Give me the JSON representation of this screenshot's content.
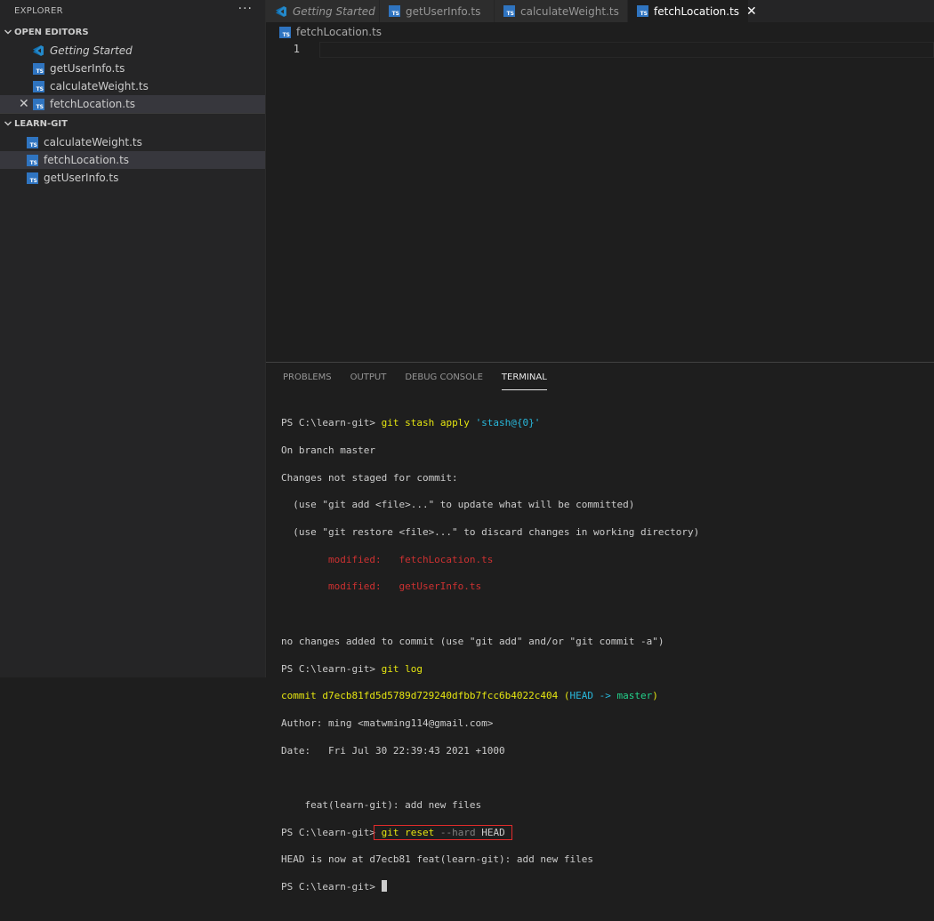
{
  "sidebar": {
    "title": "EXPLORER",
    "more": "···",
    "open_editors": {
      "label": "OPEN EDITORS",
      "items": [
        {
          "label": "Getting Started",
          "icon": "vscode-icon"
        },
        {
          "label": "getUserInfo.ts",
          "icon": "ts-file-icon"
        },
        {
          "label": "calculateWeight.ts",
          "icon": "ts-file-icon"
        },
        {
          "label": "fetchLocation.ts",
          "icon": "ts-file-icon",
          "close": "✕"
        }
      ]
    },
    "workspace": {
      "label": "LEARN-GIT",
      "files": [
        {
          "label": "calculateWeight.ts"
        },
        {
          "label": "fetchLocation.ts"
        },
        {
          "label": "getUserInfo.ts"
        }
      ]
    },
    "ts_badge": "TS"
  },
  "tabs": [
    {
      "label": "Getting Started"
    },
    {
      "label": "getUserInfo.ts"
    },
    {
      "label": "calculateWeight.ts"
    },
    {
      "label": "fetchLocation.ts",
      "close": "✕"
    }
  ],
  "breadcrumb": {
    "file": "fetchLocation.ts"
  },
  "editor": {
    "line_number": "1"
  },
  "panel": {
    "tabs": [
      "PROBLEMS",
      "OUTPUT",
      "DEBUG CONSOLE",
      "TERMINAL"
    ]
  },
  "terminal": {
    "l1_prompt": "PS C:\\learn-git> ",
    "l1_cmd": "git stash apply ",
    "l1_arg": "'stash@{0}'",
    "l2": "On branch master",
    "l3": "Changes not staged for commit:",
    "l4": "  (use \"git add <file>...\" to update what will be committed)",
    "l5": "  (use \"git restore <file>...\" to discard changes in working directory)",
    "l6": "        modified:   fetchLocation.ts",
    "l7": "        modified:   getUserInfo.ts",
    "l9": "no changes added to commit (use \"git add\" and/or \"git commit -a\")",
    "l10_prompt": "PS C:\\learn-git> ",
    "l10_cmd": "git log",
    "l11_commit": "commit d7ecb81fd5d5789d729240dfbb7fcc6b4022c404 (",
    "l11_head": "HEAD -> ",
    "l11_master": "master",
    "l11_close": ")",
    "l12": "Author: ming <matwming114@gmail.com>",
    "l13": "Date:   Fri Jul 30 22:39:43 2021 +1000",
    "l15": "    feat(learn-git): add new files",
    "l16_prompt": "PS C:\\learn-git>",
    "l16_cmd": " git reset ",
    "l16_flag": "--hard",
    "l16_arg": " HEAD",
    "l17": "HEAD is now at d7ecb81 feat(learn-git): add new files",
    "l18_prompt": "PS C:\\learn-git> "
  }
}
